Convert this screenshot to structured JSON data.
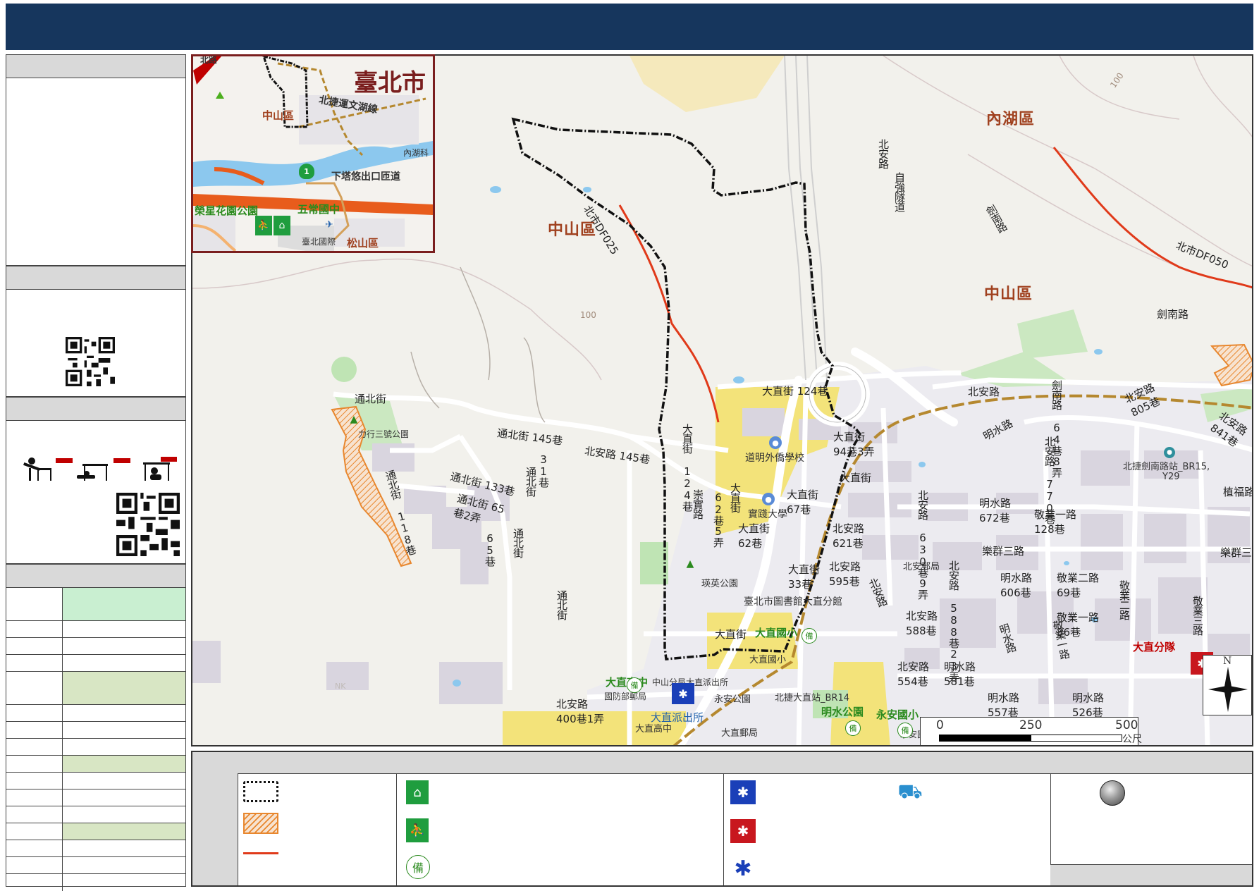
{
  "map": {
    "districts": {
      "zhongshan_main": "中山區",
      "zhongshan_east": "中山區",
      "neihu": "內湖區"
    },
    "roads": {
      "tongbei": "通北街",
      "tongbei_145": "通北街 145巷",
      "tongbei_133": "通北街 133巷",
      "tongbei_65": "通北街 65巷2弄",
      "tongbei_118": "通北街 118巷",
      "tongbei_65b": "65巷",
      "tongbei_v1": "通北街",
      "tongbei_v2": "通北街",
      "tongbei_v3": "通北街",
      "lane31": "31巷",
      "beian_145": "北安路 145巷",
      "dazhi_124": "大直街 124巷",
      "dazhi_124v": "大直街 124巷",
      "dazhi_94": "大直街 94巷3弄",
      "dazhi": "大直街",
      "dazhi_67": "大直街 67巷",
      "dazhi_62": "大直街 62巷",
      "dazhi_33": "大直街 33巷",
      "dazhi_b": "大直街",
      "dazhi_v": "大直街",
      "chongshi": "崇實路",
      "lane62": "62巷5弄",
      "beian_621": "北安路 621巷",
      "beian_595": "北安路 595巷",
      "beian_630": "北安路 630巷9弄",
      "beian_588": "北安路 588巷",
      "beian_588_23": "北安路 588巷23弄",
      "beian_554": "北安路 554巷",
      "beian_400": "北安路 400巷1弄",
      "beian_v": "北安路",
      "beian_main": "北安路",
      "beian_top": "北安路",
      "zi_qiang": "自強隧道",
      "jian_nan": "劍南路",
      "jian_nan_v": "劍南路",
      "jiannan_648": "劍南路 64巷8弄",
      "beian_805": "北安路 805巷",
      "beian_841": "北安路 841巷",
      "beian_770": "北安路 770巷",
      "mingshui": "明水路",
      "mingshui_672": "明水路 672巷",
      "mingshui_606": "明水路 606巷",
      "mingshui_581": "明水路 581巷",
      "mingshui_557": "明水路 557巷",
      "mingshui_526": "明水路 526巷",
      "mingshui_v": "明水路",
      "jingye1": "敬業一路 128巷",
      "jingye2": "敬業二路 69巷",
      "jingye1b": "敬業一路 36巷",
      "jingye1v": "敬業一路",
      "jingye2v": "敬業二路",
      "jingye3v": "敬業三路",
      "lequn3": "樂群三路",
      "lequn3b": "樂群三",
      "zhifu": "植福路",
      "df025": "北市DF025",
      "df050": "北市DF050",
      "contour1": "100",
      "contour2": "100",
      "nk": "NK"
    },
    "pois": {
      "liyuxing_park": "力行三號公園",
      "dao_ming": "道明外僑學校",
      "shih_chien": "實踐大學",
      "ying_park": "瑛英公園",
      "library": "臺北市圖書館大直分館",
      "dazhi_elem": "大直國小",
      "dazhi_elem_b": "大直國小",
      "dazhi_high": "大直高中",
      "dazhi_high_b": "大直高中",
      "police_branch": "中山分局大直派出所",
      "dazhi_police": "大直派出所",
      "post_office": "國防部郵局",
      "yongan_park": "永安公園",
      "dazhi_post": "大直郵局",
      "mrt_dazhi": "北捷大直站_BR14",
      "mingshui_park": "明水公園",
      "yongan_elem": "永安國小",
      "yongan_elem_b": "永安國小",
      "beian_post": "北安郵局",
      "mrt_jiannan": "北捷劍南路站_BR15,",
      "mrt_jiannan_b": "Y29",
      "dazhi_fire": "大直分隊"
    },
    "inset": {
      "taipei": "臺北市",
      "zhongshan": "中山區",
      "neihu": "內湖科",
      "wenhu": "北捷運文湖線",
      "xia_ta": "下塔悠出口匝道",
      "rongxing": "榮星花園公園",
      "wuchang": "五常國中",
      "airport": "臺北國際",
      "songshan": "松山區",
      "shield": "1",
      "top_road": "北路"
    },
    "scale": {
      "s0": "0",
      "s1": "250",
      "s2": "500",
      "unit": "公尺"
    },
    "compass": {
      "north": "N"
    }
  },
  "colors": {
    "header": "#16365d",
    "boundary": "#111111",
    "landslide": "#e8872e",
    "debris_flow": "#e03a1a",
    "school": "#f3e37a",
    "park": "#bfe4b4",
    "shelter_green": "#1f9d3e",
    "police_blue": "#1a3fb8",
    "fire_red": "#c8171e",
    "mrt": "#b5882f"
  }
}
